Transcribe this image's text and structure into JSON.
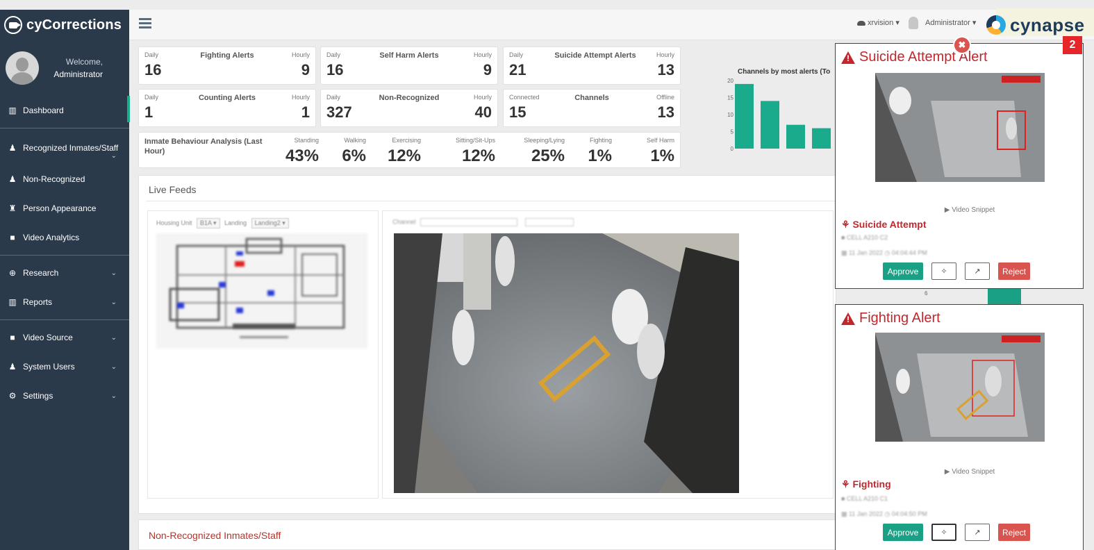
{
  "brand": {
    "name": "cyCorrections"
  },
  "user_panel": {
    "welcome": "Welcome,",
    "name": "Administrator"
  },
  "sidebar": {
    "items": [
      {
        "label": "Dashboard",
        "icon": "bar-chart-icon",
        "active": true
      },
      {
        "label": "Recognized Inmates/Staff",
        "icon": "user-secret-icon"
      },
      {
        "label": "Non-Recognized",
        "icon": "user-secret-icon"
      },
      {
        "label": "Person Appearance",
        "icon": "person-icon"
      },
      {
        "label": "Video Analytics",
        "icon": "video-camera-icon"
      },
      {
        "label": "Research",
        "icon": "search-plus-icon"
      },
      {
        "label": "Reports",
        "icon": "bar-chart-icon"
      },
      {
        "label": "Video Source",
        "icon": "video-camera-icon"
      },
      {
        "label": "System Users",
        "icon": "user-icon"
      },
      {
        "label": "Settings",
        "icon": "gears-icon"
      }
    ]
  },
  "topbar": {
    "account_menu": "xrvision",
    "user_menu": "Administrator",
    "logo_text": "cynapse"
  },
  "stats": [
    {
      "left_label": "Daily",
      "title": "Fighting Alerts",
      "right_label": "Hourly",
      "left_value": "16",
      "right_value": "9"
    },
    {
      "left_label": "Daily",
      "title": "Self Harm Alerts",
      "right_label": "Hourly",
      "left_value": "16",
      "right_value": "9"
    },
    {
      "left_label": "Daily",
      "title": "Suicide Attempt Alerts",
      "right_label": "Hourly",
      "left_value": "21",
      "right_value": "13"
    },
    {
      "left_label": "Daily",
      "title": "Counting Alerts",
      "right_label": "Hourly",
      "left_value": "1",
      "right_value": "1"
    },
    {
      "left_label": "Daily",
      "title": "Non-Recognized",
      "right_label": "Hourly",
      "left_value": "327",
      "right_value": "40"
    },
    {
      "left_label": "Connected",
      "title": "Channels",
      "right_label": "Offline",
      "left_value": "15",
      "right_value": "13"
    }
  ],
  "behaviour": {
    "title": "Inmate Behaviour Analysis (Last Hour)",
    "columns": [
      {
        "label": "Standing",
        "value": "43%"
      },
      {
        "label": "Walking",
        "value": "6%"
      },
      {
        "label": "Exercising",
        "value": "12%"
      },
      {
        "label": "Sitting/Sit-Ups",
        "value": "12%"
      },
      {
        "label": "Sleeping/Lying",
        "value": "25%"
      },
      {
        "label": "Fighting",
        "value": "1%"
      },
      {
        "label": "Self Harm",
        "value": "1%"
      }
    ]
  },
  "chart_data": {
    "type": "bar",
    "title": "Channels by most alerts (To",
    "ylim": [
      0,
      20
    ],
    "yticks": [
      "0",
      "5",
      "10",
      "15",
      "20"
    ],
    "values": [
      19,
      14,
      7,
      6
    ],
    "color": "#1aaa8c"
  },
  "live_feeds": {
    "title": "Live Feeds",
    "housing_unit_label": "Housing Unit",
    "landing_label": "Landing",
    "landing_value": "Landing2",
    "channel_label": "Channel"
  },
  "non_recognized_section": {
    "title": "Non-Recognized Inmates/Staff"
  },
  "alerts": [
    {
      "title": "Suicide Attempt Alert",
      "snippet": "▶ Video Snippet",
      "type": "Suicide Attempt",
      "approve": "Approve",
      "reject": "Reject"
    },
    {
      "title": "Fighting Alert",
      "snippet": "▶ Video Snippet",
      "type": "Fighting",
      "approve": "Approve",
      "reject": "Reject"
    }
  ],
  "alert_count": "2",
  "partial_axis_label": "6",
  "colors": {
    "sidebar": "#2b3a4a",
    "accent": "#1aaa8c",
    "alert_red": "#c1272d",
    "reject": "#d9534f"
  }
}
